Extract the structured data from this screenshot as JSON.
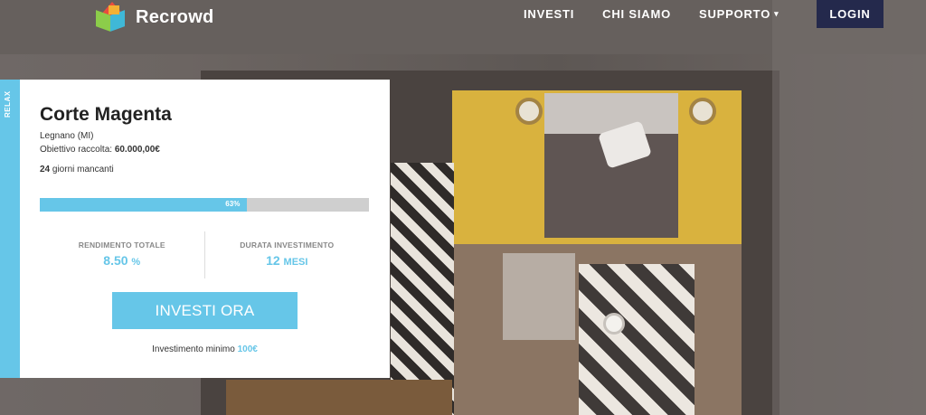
{
  "brand": {
    "name": "Recrowd"
  },
  "nav": {
    "items": [
      {
        "label": "INVESTI"
      },
      {
        "label": "CHI SIAMO"
      },
      {
        "label": "SUPPORTO",
        "caret": "▾"
      }
    ],
    "login_label": "LOGIN"
  },
  "project": {
    "category_tag": "RELAX",
    "title": "Corte Magenta",
    "location": "Legnano (MI)",
    "goal_label": "Obiettivo raccolta: ",
    "goal_value": "60.000,00€",
    "days_value": "24",
    "days_label": " giorni mancanti",
    "progress_percent": 63,
    "progress_label": "63%",
    "stats": [
      {
        "label": "RENDIMENTO TOTALE",
        "value": "8.50",
        "unit": "%"
      },
      {
        "label": "DURATA INVESTIMENTO",
        "value": "12",
        "unit": "MESI"
      }
    ],
    "cta_label": "INVESTI ORA",
    "minimum_label": "Investimento minimo ",
    "minimum_value": "100€"
  },
  "colors": {
    "accent": "#66c6e8",
    "login_bg": "#24294c",
    "progress_track": "#cfcfcf"
  }
}
